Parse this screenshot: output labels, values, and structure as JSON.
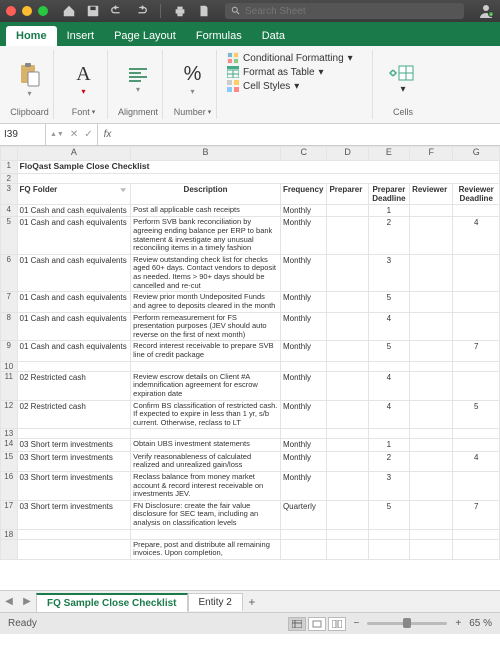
{
  "search": {
    "placeholder": "Search Sheet"
  },
  "ribbon_tabs": [
    "Home",
    "Insert",
    "Page Layout",
    "Formulas",
    "Data"
  ],
  "active_ribbon_tab": "Home",
  "ribbon_groups": {
    "clipboard": "Clipboard",
    "font": "Font",
    "alignment": "Alignment",
    "number": "Number",
    "conditional_formatting": "Conditional Formatting",
    "format_as_table": "Format as Table",
    "cell_styles": "Cell Styles",
    "cells": "Cells"
  },
  "namebox": "I39",
  "columns": [
    "",
    "A",
    "B",
    "C",
    "D",
    "E",
    "F",
    "G"
  ],
  "title": "FloQast Sample Close Checklist",
  "headers": {
    "folder": "FQ Folder",
    "description": "Description",
    "frequency": "Frequency",
    "preparer": "Preparer",
    "preparer_deadline": "Preparer Deadline",
    "reviewer": "Reviewer",
    "reviewer_deadline": "Reviewer Deadline"
  },
  "rows": [
    {
      "n": "4",
      "folder": "01 Cash and cash equivalents",
      "desc": "Post all applicable cash receipts",
      "freq": "Monthly",
      "pd": "1",
      "rd": ""
    },
    {
      "n": "5",
      "folder": "01 Cash and cash equivalents",
      "desc": "Perform SVB bank reconciliation by agreeing ending balance per ERP to bank statement & investigate any unusual reconciling items in a timely fashion",
      "freq": "Monthly",
      "pd": "2",
      "rd": "4"
    },
    {
      "n": "6",
      "folder": "01 Cash and cash equivalents",
      "desc": "Review outstanding check list for checks aged 60+ days. Contact vendors to deposit as needed. Items > 90+ days should be cancelled and re-cut",
      "freq": "Monthly",
      "pd": "3",
      "rd": ""
    },
    {
      "n": "7",
      "folder": "01 Cash and cash equivalents",
      "desc": "Review prior month Undeposited Funds and agree to deposits cleared in the month",
      "freq": "Monthly",
      "pd": "5",
      "rd": ""
    },
    {
      "n": "8",
      "folder": "01 Cash and cash equivalents",
      "desc": "Perform remeasurement for FS presentation purposes (JEV should auto reverse on the first of next month)",
      "freq": "Monthly",
      "pd": "4",
      "rd": ""
    },
    {
      "n": "9",
      "folder": "01 Cash and cash equivalents",
      "desc": "Record interest receivable to prepare SVB line of credit package",
      "freq": "Monthly",
      "pd": "5",
      "rd": "7"
    },
    {
      "n": "10",
      "folder": "",
      "desc": "",
      "freq": "",
      "pd": "",
      "rd": ""
    },
    {
      "n": "11",
      "folder": "02 Restricted cash",
      "desc": "Review escrow details on Client #A indemnification agreement for escrow expiration date",
      "freq": "Monthly",
      "pd": "4",
      "rd": ""
    },
    {
      "n": "12",
      "folder": "02 Restricted cash",
      "desc": "Confirm BS classification of restricted cash. If expected to expire in less than 1 yr, s/b current. Otherwise, reclass to LT",
      "freq": "Monthly",
      "pd": "4",
      "rd": "5"
    },
    {
      "n": "13",
      "folder": "",
      "desc": "",
      "freq": "",
      "pd": "",
      "rd": ""
    },
    {
      "n": "14",
      "folder": "03 Short term investments",
      "desc": "Obtain UBS investment statements",
      "freq": "Monthly",
      "pd": "1",
      "rd": ""
    },
    {
      "n": "15",
      "folder": "03 Short term investments",
      "desc": "Verify reasonableness of calculated realized and unrealized gain/loss",
      "freq": "Monthly",
      "pd": "2",
      "rd": "4"
    },
    {
      "n": "16",
      "folder": "03 Short term investments",
      "desc": "Reclass balance from money market account & record interest receivable on investments JEV.",
      "freq": "Monthly",
      "pd": "3",
      "rd": ""
    },
    {
      "n": "17",
      "folder": "03 Short term investments",
      "desc": "FN Disclosure: create the fair value disclosure for SEC team, including an analysis on classification levels",
      "freq": "Quarterly",
      "pd": "5",
      "rd": "7"
    },
    {
      "n": "18",
      "folder": "",
      "desc": "",
      "freq": "",
      "pd": "",
      "rd": ""
    },
    {
      "n": "",
      "folder": "",
      "desc": "Prepare, post and distribute all remaining invoices. Upon completion,",
      "freq": "",
      "pd": "",
      "rd": ""
    }
  ],
  "sheet_tabs": [
    "FQ Sample Close Checklist",
    "Entity 2"
  ],
  "active_sheet": "FQ Sample Close Checklist",
  "status": {
    "ready": "Ready",
    "zoom": "65 %"
  }
}
